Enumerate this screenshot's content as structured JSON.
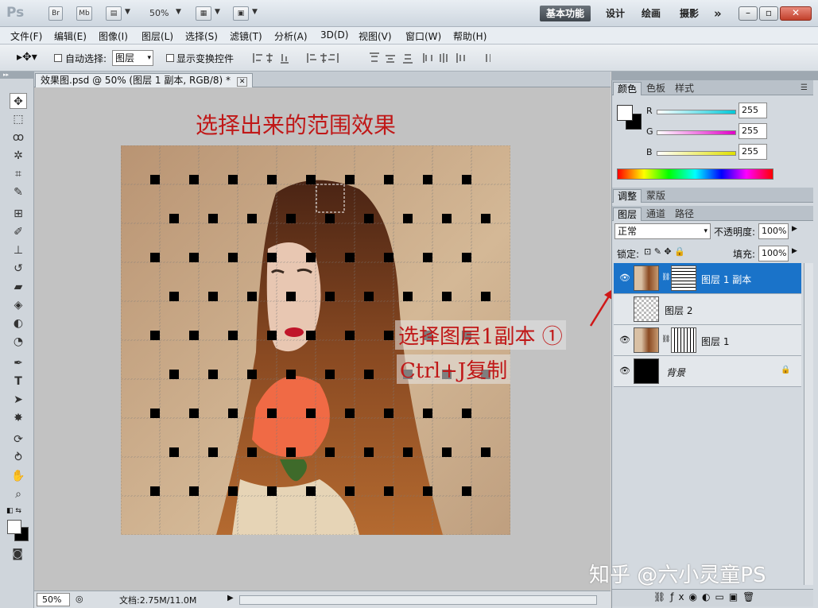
{
  "titlebar": {
    "logo": "Ps",
    "br_label": "Br",
    "mb_label": "Mb",
    "zoom": "50%",
    "workspaces": [
      "基本功能",
      "设计",
      "绘画",
      "摄影"
    ],
    "more": "»"
  },
  "menu": [
    "文件(F)",
    "编辑(E)",
    "图像(I)",
    "图层(L)",
    "选择(S)",
    "滤镜(T)",
    "分析(A)",
    "3D(D)",
    "视图(V)",
    "窗口(W)",
    "帮助(H)"
  ],
  "options": {
    "auto_select_label": "自动选择:",
    "auto_select_value": "图层",
    "show_transform_label": "显示变换控件"
  },
  "document": {
    "tab_title": "效果图.psd @ 50% (图层 1 副本, RGB/8) *",
    "canvas_heading": "选择出来的范围效果"
  },
  "status": {
    "zoom": "50%",
    "doc_size": "文档:2.75M/11.0M"
  },
  "color_panel": {
    "tabs": [
      "颜色",
      "色板",
      "样式"
    ],
    "channels": [
      {
        "label": "R",
        "value": "255",
        "color": "#00c8d8"
      },
      {
        "label": "G",
        "value": "255",
        "color": "#e000c8"
      },
      {
        "label": "B",
        "value": "255",
        "color": "#e0e000"
      }
    ]
  },
  "adjust_panel": {
    "tabs": [
      "调整",
      "蒙版"
    ]
  },
  "layers_panel": {
    "tabs": [
      "图层",
      "通道",
      "路径"
    ],
    "blend_mode": "正常",
    "opacity_label": "不透明度:",
    "opacity_value": "100%",
    "lock_label": "锁定:",
    "fill_label": "填充:",
    "fill_value": "100%",
    "layers": [
      {
        "name": "图层 1 副本",
        "selected": true
      },
      {
        "name": "图层 2",
        "selected": false
      },
      {
        "name": "图层 1",
        "selected": false
      },
      {
        "name": "背景",
        "selected": false
      }
    ]
  },
  "annotation": {
    "line1": "选择图层1副本 ①",
    "line2": "Ctrl+J复制"
  },
  "watermark": "知乎 @六小灵童PS"
}
